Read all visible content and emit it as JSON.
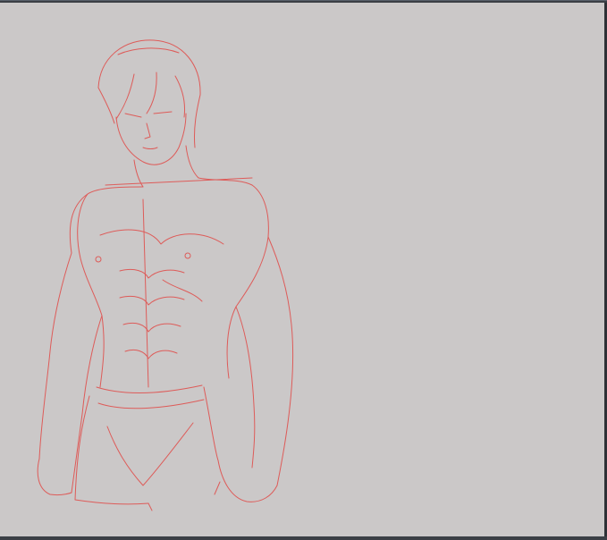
{
  "app": {
    "canvas_background": "#cbc8c8",
    "chrome_color": "#3b3f45",
    "sketch_color": "#e0504d"
  },
  "icons": {
    "minimize": "minimize-icon"
  },
  "canvas": {
    "subject": "sketch-drawing"
  }
}
